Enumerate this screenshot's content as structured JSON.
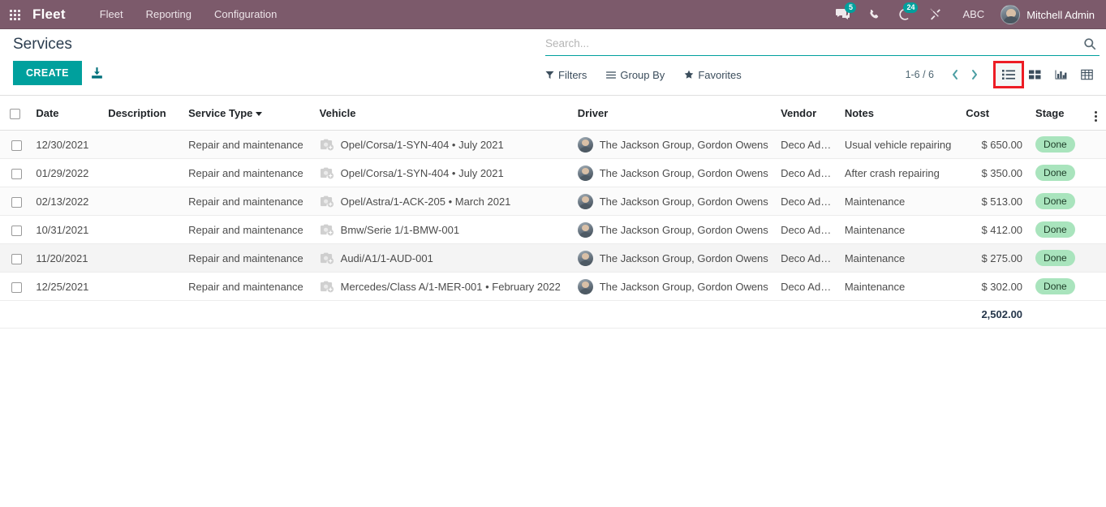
{
  "navbar": {
    "apps_icon": "apps-grid-icon",
    "brand": "Fleet",
    "menus": [
      {
        "label": "Fleet"
      },
      {
        "label": "Reporting"
      },
      {
        "label": "Configuration"
      }
    ],
    "systray": [
      {
        "name": "messages-icon",
        "badge": "5"
      },
      {
        "name": "phone-icon",
        "badge": ""
      },
      {
        "name": "activity-clock-icon",
        "badge": "24"
      },
      {
        "name": "tools-icon",
        "badge": ""
      }
    ],
    "company": "ABC",
    "user_name": "Mitchell Admin",
    "bg_color": "#7C5A6B",
    "badge_color": "#00A09D"
  },
  "control_panel": {
    "title": "Services",
    "create_label": "CREATE",
    "create_color": "#00A09D",
    "import_icon": "import-download-icon",
    "search": {
      "placeholder": "Search...",
      "value": "",
      "search_icon": "search-icon"
    },
    "filters_label": "Filters",
    "group_by_label": "Group By",
    "favorites_label": "Favorites",
    "pager": "1-6 / 6",
    "prev_icon": "chevron-left-icon",
    "next_icon": "chevron-right-icon",
    "views": [
      {
        "name": "list-view-icon",
        "label": "List",
        "active": true,
        "highlighted": true
      },
      {
        "name": "kanban-view-icon",
        "label": "Kanban",
        "active": false,
        "highlighted": false
      },
      {
        "name": "graph-view-icon",
        "label": "Graph",
        "active": false,
        "highlighted": false
      },
      {
        "name": "pivot-view-icon",
        "label": "Pivot",
        "active": false,
        "highlighted": false
      }
    ],
    "highlight_color": "#ED1C24"
  },
  "table": {
    "columns": [
      {
        "key": "date",
        "label": "Date"
      },
      {
        "key": "description",
        "label": "Description"
      },
      {
        "key": "service_type",
        "label": "Service Type",
        "sorted": true
      },
      {
        "key": "vehicle",
        "label": "Vehicle"
      },
      {
        "key": "driver",
        "label": "Driver"
      },
      {
        "key": "vendor",
        "label": "Vendor"
      },
      {
        "key": "notes",
        "label": "Notes"
      },
      {
        "key": "cost",
        "label": "Cost"
      },
      {
        "key": "stage",
        "label": "Stage"
      }
    ],
    "optional_columns_icon": "vertical-dots-icon",
    "rows": [
      {
        "date": "12/30/2021",
        "description": "",
        "service_type": "Repair and maintenance",
        "vehicle": "Opel/Corsa/1-SYN-404 • July 2021",
        "driver": "The Jackson Group, Gordon Owens",
        "vendor": "Deco Addict",
        "notes": "Usual vehicle repairing",
        "cost": "$ 650.00",
        "stage": "Done",
        "hovered": false
      },
      {
        "date": "01/29/2022",
        "description": "",
        "service_type": "Repair and maintenance",
        "vehicle": "Opel/Corsa/1-SYN-404 • July 2021",
        "driver": "The Jackson Group, Gordon Owens",
        "vendor": "Deco Addict",
        "notes": "After crash repairing",
        "cost": "$ 350.00",
        "stage": "Done",
        "hovered": false
      },
      {
        "date": "02/13/2022",
        "description": "",
        "service_type": "Repair and maintenance",
        "vehicle": "Opel/Astra/1-ACK-205 • March 2021",
        "driver": "The Jackson Group, Gordon Owens",
        "vendor": "Deco Addict",
        "notes": "Maintenance",
        "cost": "$ 513.00",
        "stage": "Done",
        "hovered": false
      },
      {
        "date": "10/31/2021",
        "description": "",
        "service_type": "Repair and maintenance",
        "vehicle": "Bmw/Serie 1/1-BMW-001",
        "driver": "The Jackson Group, Gordon Owens",
        "vendor": "Deco Addict",
        "notes": "Maintenance",
        "cost": "$ 412.00",
        "stage": "Done",
        "hovered": false
      },
      {
        "date": "11/20/2021",
        "description": "",
        "service_type": "Repair and maintenance",
        "vehicle": "Audi/A1/1-AUD-001",
        "driver": "The Jackson Group, Gordon Owens",
        "vendor": "Deco Addict",
        "notes": "Maintenance",
        "cost": "$ 275.00",
        "stage": "Done",
        "hovered": true
      },
      {
        "date": "12/25/2021",
        "description": "",
        "service_type": "Repair and maintenance",
        "vehicle": "Mercedes/Class A/1-MER-001 • February 2022",
        "driver": "The Jackson Group, Gordon Owens",
        "vendor": "Deco Addict",
        "notes": "Maintenance",
        "cost": "$ 302.00",
        "stage": "Done",
        "hovered": false
      }
    ],
    "total_cost": "2,502.00",
    "stage_badge_color": "#A9E4BD"
  }
}
